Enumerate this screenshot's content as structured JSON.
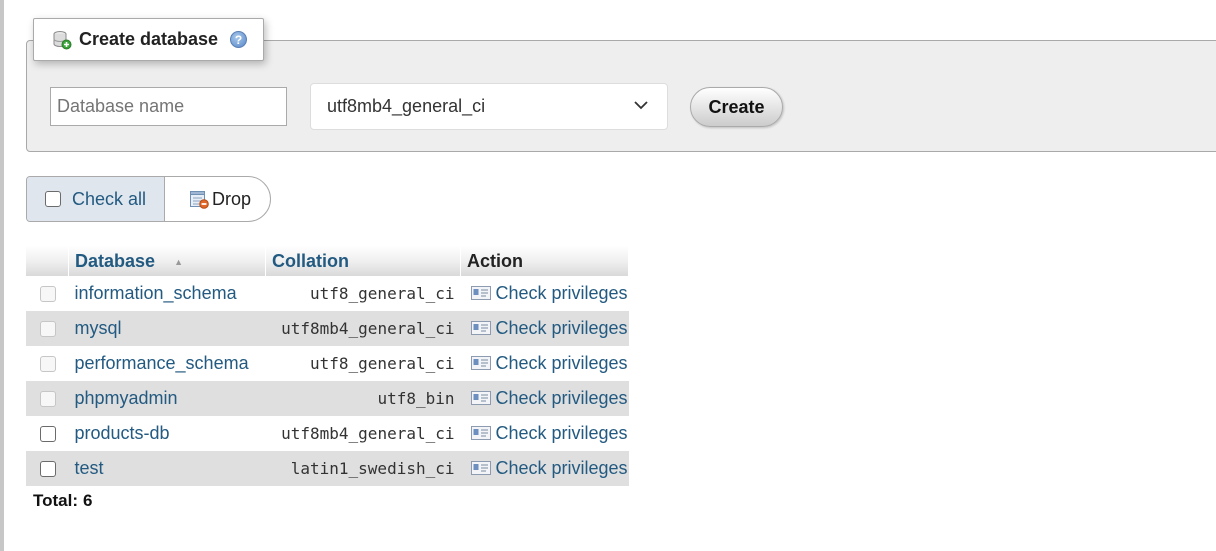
{
  "create_database": {
    "title": "Create database",
    "name_placeholder": "Database name",
    "collation_selected": "utf8mb4_general_ci",
    "create_label": "Create"
  },
  "bulk_actions": {
    "check_all_label": "Check all",
    "drop_label": "Drop"
  },
  "table": {
    "headers": {
      "database": "Database",
      "collation": "Collation",
      "action": "Action"
    },
    "rows": [
      {
        "name": "information_schema",
        "collation": "utf8_general_ci",
        "action": "Check privileges",
        "checkbox_enabled": false
      },
      {
        "name": "mysql",
        "collation": "utf8mb4_general_ci",
        "action": "Check privileges",
        "checkbox_enabled": false
      },
      {
        "name": "performance_schema",
        "collation": "utf8_general_ci",
        "action": "Check privileges",
        "checkbox_enabled": false
      },
      {
        "name": "phpmyadmin",
        "collation": "utf8_bin",
        "action": "Check privileges",
        "checkbox_enabled": false
      },
      {
        "name": "products-db",
        "collation": "utf8mb4_general_ci",
        "action": "Check privileges",
        "checkbox_enabled": true
      },
      {
        "name": "test",
        "collation": "latin1_swedish_ci",
        "action": "Check privileges",
        "checkbox_enabled": true
      }
    ]
  },
  "summary": {
    "total_label": "Total:",
    "total_value": "6"
  },
  "colors": {
    "link": "#235a81",
    "panel_bg": "#eeeeee",
    "row_alt": "#dfdfdf",
    "check_all_bg": "#dfe6ed"
  },
  "icons": [
    "database-add-icon",
    "help-icon",
    "chevron-down-icon",
    "drop-icon",
    "sort-ascending-icon",
    "privileges-icon"
  ]
}
